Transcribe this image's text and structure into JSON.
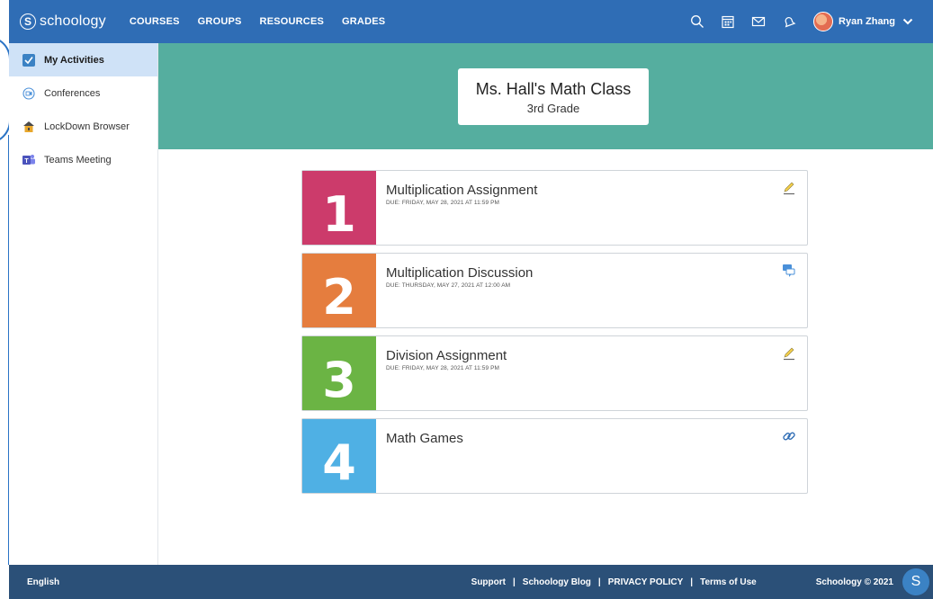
{
  "header": {
    "logo_letter": "S",
    "logo_text": "schoology",
    "nav": [
      "COURSES",
      "GROUPS",
      "RESOURCES",
      "GRADES"
    ],
    "user_name": "Ryan Zhang"
  },
  "sidebar": {
    "items": [
      {
        "label": "My Activities",
        "icon": "activities-icon"
      },
      {
        "label": "Conferences",
        "icon": "conferences-icon"
      },
      {
        "label": "LockDown Browser",
        "icon": "lockdown-icon"
      },
      {
        "label": "Teams Meeting",
        "icon": "teams-icon"
      }
    ]
  },
  "banner": {
    "title": "Ms. Hall's Math Class",
    "subtitle": "3rd Grade"
  },
  "cards": [
    {
      "number": "1",
      "color": "#cc3b6b",
      "title": "Multiplication Assignment",
      "due": "DUE: FRIDAY, MAY 28, 2021 AT 11:59 PM",
      "icon": "pencil-icon"
    },
    {
      "number": "2",
      "color": "#e57d3e",
      "title": "Multiplication Discussion",
      "due": "DUE: THURSDAY, MAY 27, 2021 AT 12:00 AM",
      "icon": "discussion-icon"
    },
    {
      "number": "3",
      "color": "#6bb444",
      "title": "Division Assignment",
      "due": "DUE: FRIDAY, MAY 28, 2021 AT 11:59 PM",
      "icon": "pencil-icon"
    },
    {
      "number": "4",
      "color": "#4fb0e4",
      "title": "Math Games",
      "due": "",
      "icon": "link-icon"
    }
  ],
  "footer": {
    "language": "English",
    "links": [
      "Support",
      "Schoology Blog",
      "PRIVACY POLICY",
      "Terms of Use"
    ],
    "separator": "|",
    "copyright": "Schoology © 2021",
    "badge": "S"
  },
  "colors": {
    "nav": "#2f6db5",
    "banner": "#55ae9f",
    "footer": "#2b5078",
    "sidebar_active": "#cfe2f7"
  }
}
